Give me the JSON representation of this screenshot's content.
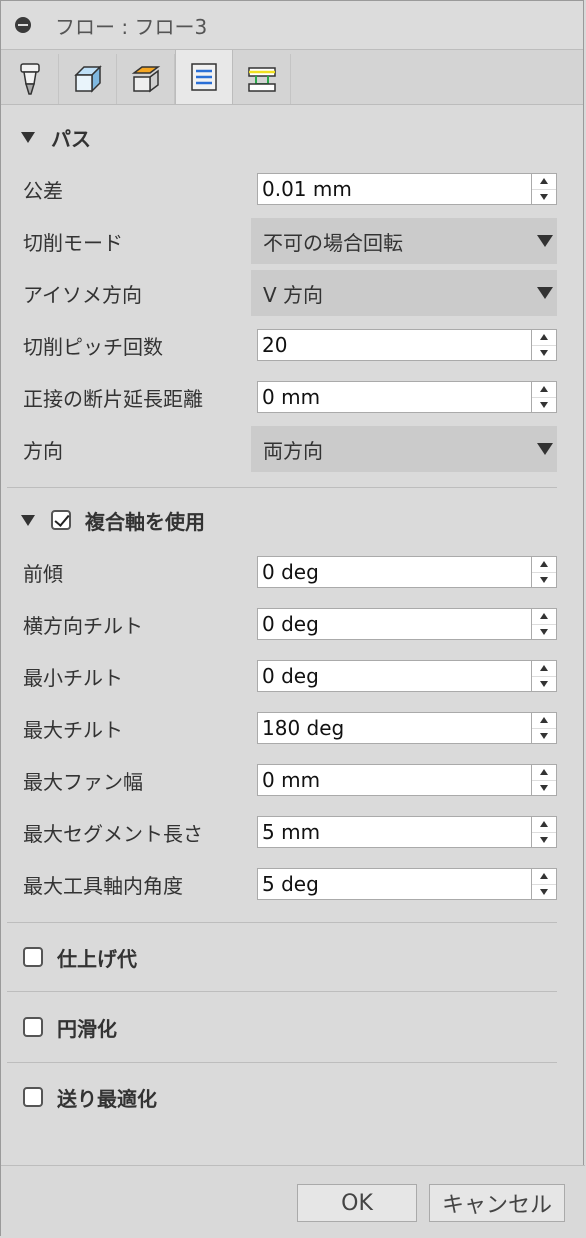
{
  "window": {
    "title": "フロー : フロー3"
  },
  "tabs": [
    {
      "icon": "tool-icon"
    },
    {
      "icon": "geometry-icon"
    },
    {
      "icon": "heights-icon"
    },
    {
      "icon": "passes-icon",
      "active": true
    },
    {
      "icon": "linking-icon"
    }
  ],
  "passes": {
    "header": "パス",
    "tolerance": {
      "label": "公差",
      "value": "0.01 mm"
    },
    "cutting_mode": {
      "label": "切削モード",
      "value": "不可の場合回転"
    },
    "isometric_direction": {
      "label": "アイソメ方向",
      "value": "V 方向"
    },
    "stepover_count": {
      "label": "切削ピッチ回数",
      "value": "20"
    },
    "tangential_extension": {
      "label": "正接の断片延長距離",
      "value": "0 mm"
    },
    "direction": {
      "label": "方向",
      "value": "両方向"
    }
  },
  "multi_axis": {
    "header": "複合軸を使用",
    "checked": true,
    "lead_angle": {
      "label": "前傾",
      "value": "0 deg"
    },
    "lateral_tilt": {
      "label": "横方向チルト",
      "value": "0 deg"
    },
    "min_tilt": {
      "label": "最小チルト",
      "value": "0 deg"
    },
    "max_tilt": {
      "label": "最大チルト",
      "value": "180 deg"
    },
    "max_fan": {
      "label": "最大ファン幅",
      "value": "0 mm"
    },
    "max_segment": {
      "label": "最大セグメント長さ",
      "value": "5 mm"
    },
    "max_tool_axis_angle": {
      "label": "最大工具軸内角度",
      "value": "5 deg"
    }
  },
  "stock_to_leave": {
    "label": "仕上げ代",
    "checked": false
  },
  "smoothing": {
    "label": "円滑化",
    "checked": false
  },
  "feed_optimization": {
    "label": "送り最適化",
    "checked": false
  },
  "buttons": {
    "ok": "OK",
    "cancel": "キャンセル"
  }
}
